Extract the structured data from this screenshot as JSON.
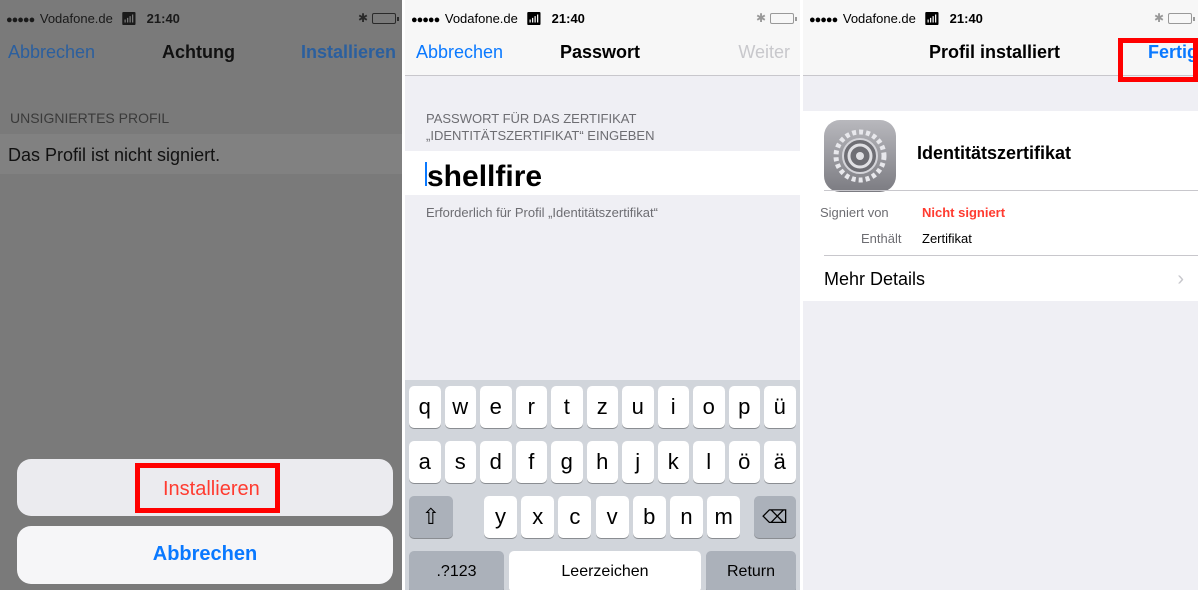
{
  "status": {
    "carrier": "Vodafone.de",
    "time": "21:40",
    "signal": "●●●●●"
  },
  "screen1": {
    "nav": {
      "left": "Abbrechen",
      "title": "Achtung",
      "right": "Installieren"
    },
    "section_header": "UNSIGNIERTES PROFIL",
    "cell_text": "Das Profil ist nicht signiert.",
    "sheet": {
      "install": "Installieren",
      "cancel": "Abbrechen"
    }
  },
  "screen2": {
    "nav": {
      "left": "Abbrechen",
      "title": "Passwort",
      "right": "Weiter"
    },
    "header_line1": "PASSWORT FÜR DAS ZERTIFIKAT",
    "header_line2": "„IDENTITÄTSZERTIFIKAT“ EINGEBEN",
    "password_value": "shellfire",
    "footer": "Erforderlich für Profil „Identitätszertifikat“",
    "keyboard": {
      "row1": [
        "q",
        "w",
        "e",
        "r",
        "t",
        "z",
        "u",
        "i",
        "o",
        "p",
        "ü"
      ],
      "row2": [
        "a",
        "s",
        "d",
        "f",
        "g",
        "h",
        "j",
        "k",
        "l",
        "ö",
        "ä"
      ],
      "row3": [
        "y",
        "x",
        "c",
        "v",
        "b",
        "n",
        "m"
      ],
      "numbers": ".?123",
      "space": "Leerzeichen",
      "return": "Return"
    }
  },
  "screen3": {
    "nav": {
      "title": "Profil installiert",
      "right": "Fertig"
    },
    "profile_name": "Identitätszertifikat",
    "signed_by_label": "Signiert von",
    "signed_by_value": "Nicht signiert",
    "contains_label": "Enthält",
    "contains_value": "Zertifikat",
    "more_details": "Mehr Details"
  },
  "colors": {
    "ios_blue": "#0a79ff",
    "warning_red": "#ff3b30",
    "highlight_box": "#ff0000"
  }
}
